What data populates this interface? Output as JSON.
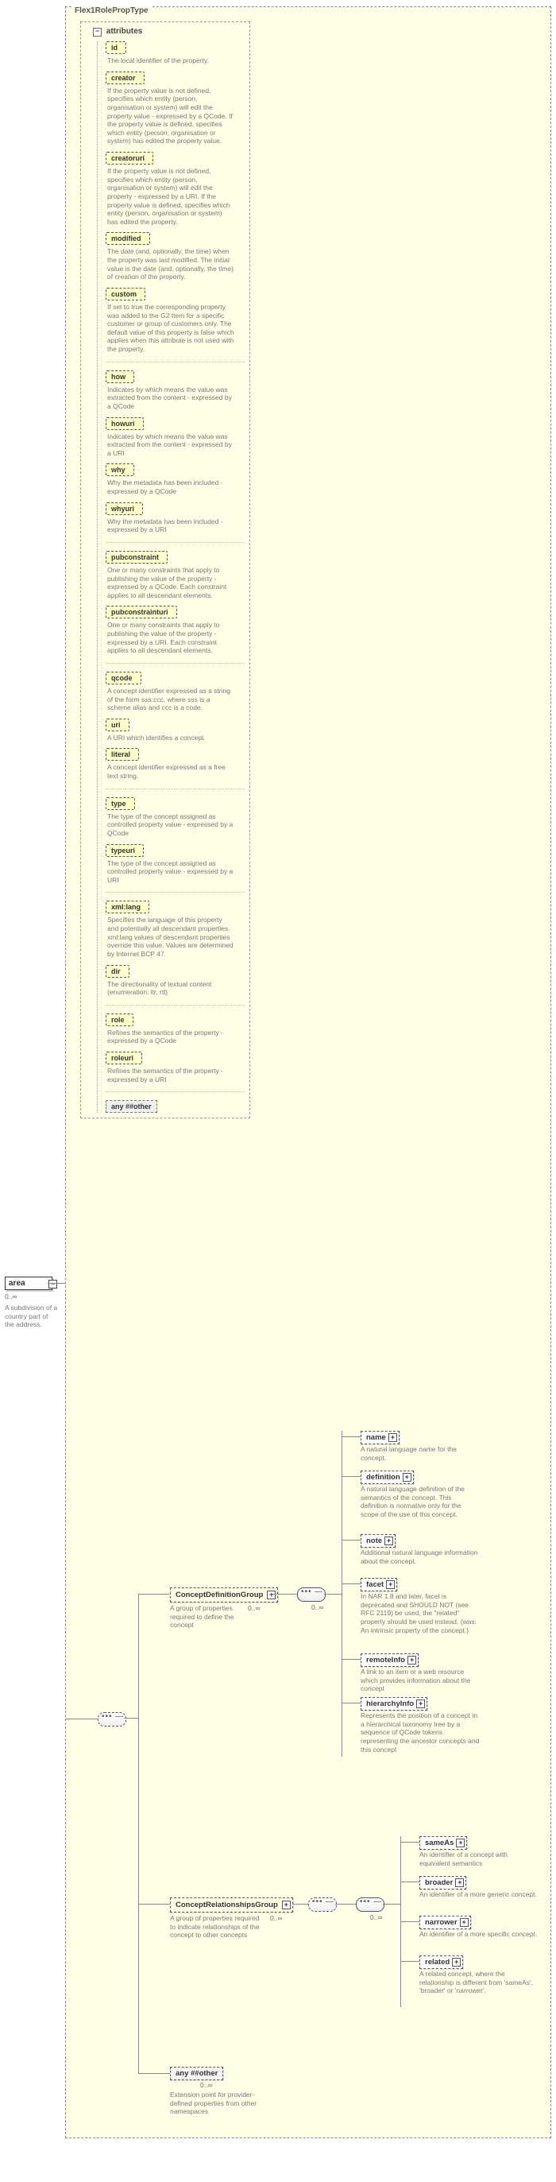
{
  "root": {
    "name": "area",
    "range": "0..∞",
    "desc": "A subdivision of a country part of the address."
  },
  "outer_title": "Flex1RolePropType",
  "attr_header": "attributes",
  "any_attr": "any ##other",
  "attrs": [
    {
      "name": "id",
      "desc": "The local identifier of the property."
    },
    {
      "name": "creator",
      "desc": "If the property value is not defined, specifies which entity (person, organisation or system) will edit the property value - expressed by a QCode. If the property value is defined, specifies which entity (person, organisation or system) has edited the property value."
    },
    {
      "name": "creatoruri",
      "desc": "If the property value is not defined, specifies which entity (person, organisation or system) will edit the property - expressed by a URI. If the property value is defined, specifies which entity (person, organisation or system) has edited the property."
    },
    {
      "name": "modified",
      "desc": "The date (and, optionally, the time) when the property was last modified. The initial value is the date (and, optionally, the time) of creation of the property."
    },
    {
      "name": "custom",
      "desc": "If set to true the corresponding property was added to the G2 Item for a specific customer or group of customers only. The default value of this property is false which applies when this attribute is not used with the property."
    },
    {
      "name": "how",
      "desc": "Indicates by which means the value was extracted from the content - expressed by a QCode"
    },
    {
      "name": "howuri",
      "desc": "Indicates by which means the value was extracted from the content - expressed by a URI"
    },
    {
      "name": "why",
      "desc": "Why the metadata has been included - expressed by a QCode"
    },
    {
      "name": "whyuri",
      "desc": "Why the metadata has been included - expressed by a URI"
    },
    {
      "name": "pubconstraint",
      "desc": "One or many constraints that apply to publishing the value of the property - expressed by a QCode. Each constraint applies to all descendant elements."
    },
    {
      "name": "pubconstrainturi",
      "desc": "One or many constraints that apply to publishing the value of the property - expressed by a URI. Each constraint applies to all descendant elements."
    },
    {
      "name": "qcode",
      "desc": "A concept identifier expressed as a string of the form sss:ccc, where sss is a scheme alias and ccc is a code."
    },
    {
      "name": "uri",
      "desc": "A URI which identifies a concept."
    },
    {
      "name": "literal",
      "desc": "A concept identifier expressed as a free text string."
    },
    {
      "name": "type",
      "desc": "The type of the concept assigned as controlled property value - expressed by a QCode"
    },
    {
      "name": "typeuri",
      "desc": "The type of the concept assigned as controlled property value - expressed by a URI"
    },
    {
      "name": "xml:lang",
      "desc": "Specifies the language of this property and potentially all descendant properties. xml:lang values of descendant properties override this value. Values are determined by Internet BCP 47."
    },
    {
      "name": "dir",
      "desc": "The directionality of textual content (enumeration: ltr, rtl)"
    },
    {
      "name": "role",
      "desc": "Refines the semantics of the property - expressed by a QCode"
    },
    {
      "name": "roleuri",
      "desc": "Refines the semantics of the property - expressed by a URI"
    }
  ],
  "def_group": {
    "name": "ConceptDefinitionGroup",
    "range": "0..∞",
    "desc": "A group of properties required to define the concept"
  },
  "def_elems": [
    {
      "name": "name",
      "desc": "A natural language name for the concept."
    },
    {
      "name": "definition",
      "desc": "A natural language definition of the semantics of the concept. This definition is normative only for the scope of the use of this concept."
    },
    {
      "name": "note",
      "desc": "Additional natural language information about the concept."
    },
    {
      "name": "facet",
      "desc": "In NAR 1.8 and later, facet is deprecated and SHOULD NOT (see RFC 2119) be used, the \"related\" property should be used instead. (was: An intrinsic property of the concept.)"
    },
    {
      "name": "remoteInfo",
      "desc": "A link to an item or a web resource which provides information about the concept"
    },
    {
      "name": "hierarchyInfo",
      "desc": "Represents the position of a concept in a hierarchical taxonomy tree by a sequence of QCode tokens representing the ancestor concepts and this concept"
    }
  ],
  "rel_group": {
    "name": "ConceptRelationshipsGroup",
    "range": "0..∞",
    "desc": "A group of properties required to indicate relationships of the concept to other concepts"
  },
  "rel_elems": [
    {
      "name": "sameAs",
      "desc": "An identifier of a concept with equivalent semantics"
    },
    {
      "name": "broader",
      "desc": "An identifier of a more generic concept."
    },
    {
      "name": "narrower",
      "desc": "An identifier of a more specific concept."
    },
    {
      "name": "related",
      "desc": "A related concept, where the relationship is different from 'sameAs', 'broader' or 'narrower'."
    }
  ],
  "any_elem": {
    "name": "any ##other",
    "range": "0..∞",
    "desc": "Extension point for provider-defined properties from other namespaces"
  }
}
